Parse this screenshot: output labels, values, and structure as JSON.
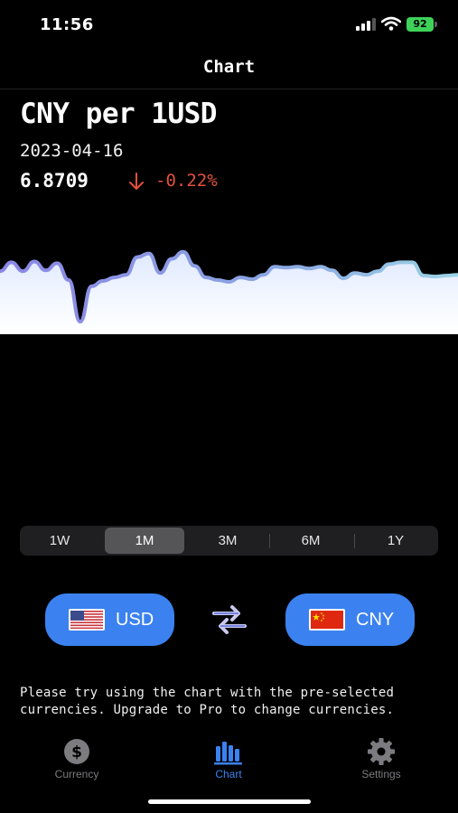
{
  "status_bar": {
    "time": "11:56",
    "battery": "92"
  },
  "nav": {
    "title": "Chart"
  },
  "rate": {
    "pair_title": "CNY per 1USD",
    "date": "2023-04-16",
    "value": "6.8709",
    "change": "-0.22%",
    "change_direction": "down",
    "change_color": "#e2513e"
  },
  "chart_data": {
    "type": "area",
    "title": "",
    "xlabel": "",
    "ylabel": "",
    "y": [
      0.62,
      0.72,
      0.62,
      0.73,
      0.63,
      0.71,
      0.52,
      0.05,
      0.45,
      0.51,
      0.55,
      0.58,
      0.78,
      0.82,
      0.6,
      0.76,
      0.84,
      0.68,
      0.55,
      0.52,
      0.5,
      0.55,
      0.53,
      0.58,
      0.67,
      0.66,
      0.67,
      0.65,
      0.67,
      0.63,
      0.54,
      0.6,
      0.58,
      0.62,
      0.7,
      0.72,
      0.72,
      0.57,
      0.56,
      0.57,
      0.58
    ],
    "line_color": "#7f8fe0",
    "fill_color": "#ffffff"
  },
  "range_selector": {
    "options": [
      "1W",
      "1M",
      "3M",
      "6M",
      "1Y"
    ],
    "selected": "1M"
  },
  "from_currency": {
    "code": "USD",
    "flag": "us-flag-icon"
  },
  "to_currency": {
    "code": "CNY",
    "flag": "cn-flag-icon"
  },
  "accent_color": "#3b82f0",
  "upgrade_note": "Please try using the chart with the pre-selected currencies. Upgrade to Pro to change currencies.",
  "tabs": [
    {
      "label": "Currency",
      "icon": "dollar-icon",
      "active": false
    },
    {
      "label": "Chart",
      "icon": "bar-chart-icon",
      "active": true
    },
    {
      "label": "Settings",
      "icon": "gear-icon",
      "active": false
    }
  ]
}
